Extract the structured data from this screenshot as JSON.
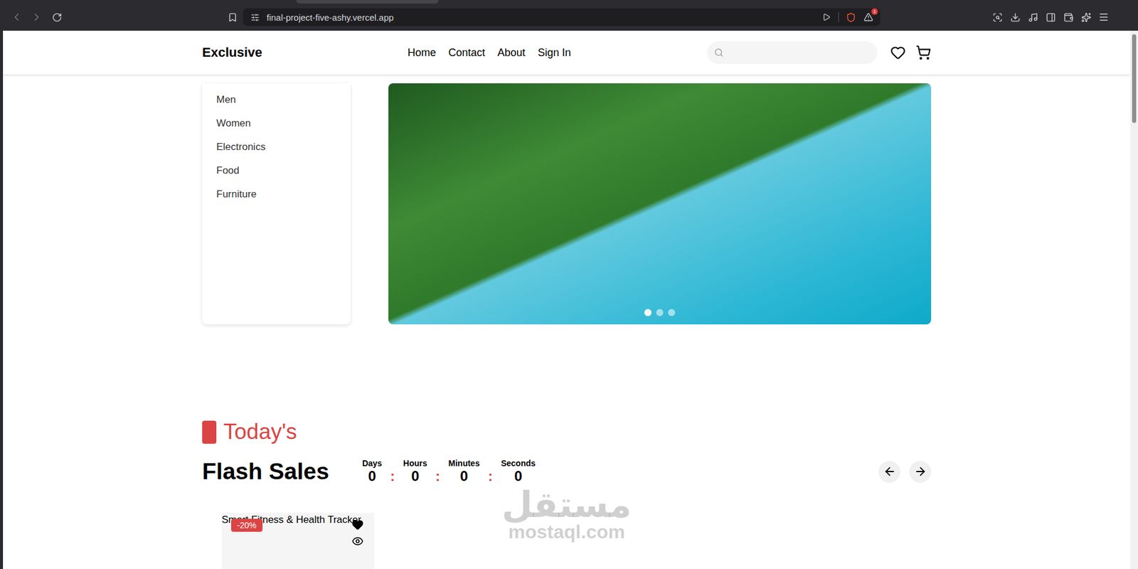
{
  "browser": {
    "url": "final-project-five-ashy.vercel.app",
    "notification_count": "1"
  },
  "header": {
    "logo": "Exclusive",
    "nav": [
      {
        "label": "Home"
      },
      {
        "label": "Contact"
      },
      {
        "label": "About"
      },
      {
        "label": "Sign In"
      }
    ]
  },
  "categories": [
    {
      "label": "Men"
    },
    {
      "label": "Women"
    },
    {
      "label": "Electronics"
    },
    {
      "label": "Food"
    },
    {
      "label": "Furniture"
    }
  ],
  "hero": {
    "slides": [
      {
        "selected": true
      },
      {
        "selected": false
      },
      {
        "selected": false
      }
    ]
  },
  "flash_sales": {
    "label": "Today's",
    "title": "Flash Sales",
    "separator": ":",
    "timer": [
      {
        "unit": "Days",
        "value": "0"
      },
      {
        "unit": "Hours",
        "value": "0"
      },
      {
        "unit": "Minutes",
        "value": "0"
      },
      {
        "unit": "Seconds",
        "value": "0"
      }
    ]
  },
  "products": [
    {
      "name": "Smart Fitness & Health Tracker",
      "discount": "-20%"
    }
  ],
  "watermark": {
    "arabic": "مستقل",
    "latin": "mostaql.com"
  }
}
